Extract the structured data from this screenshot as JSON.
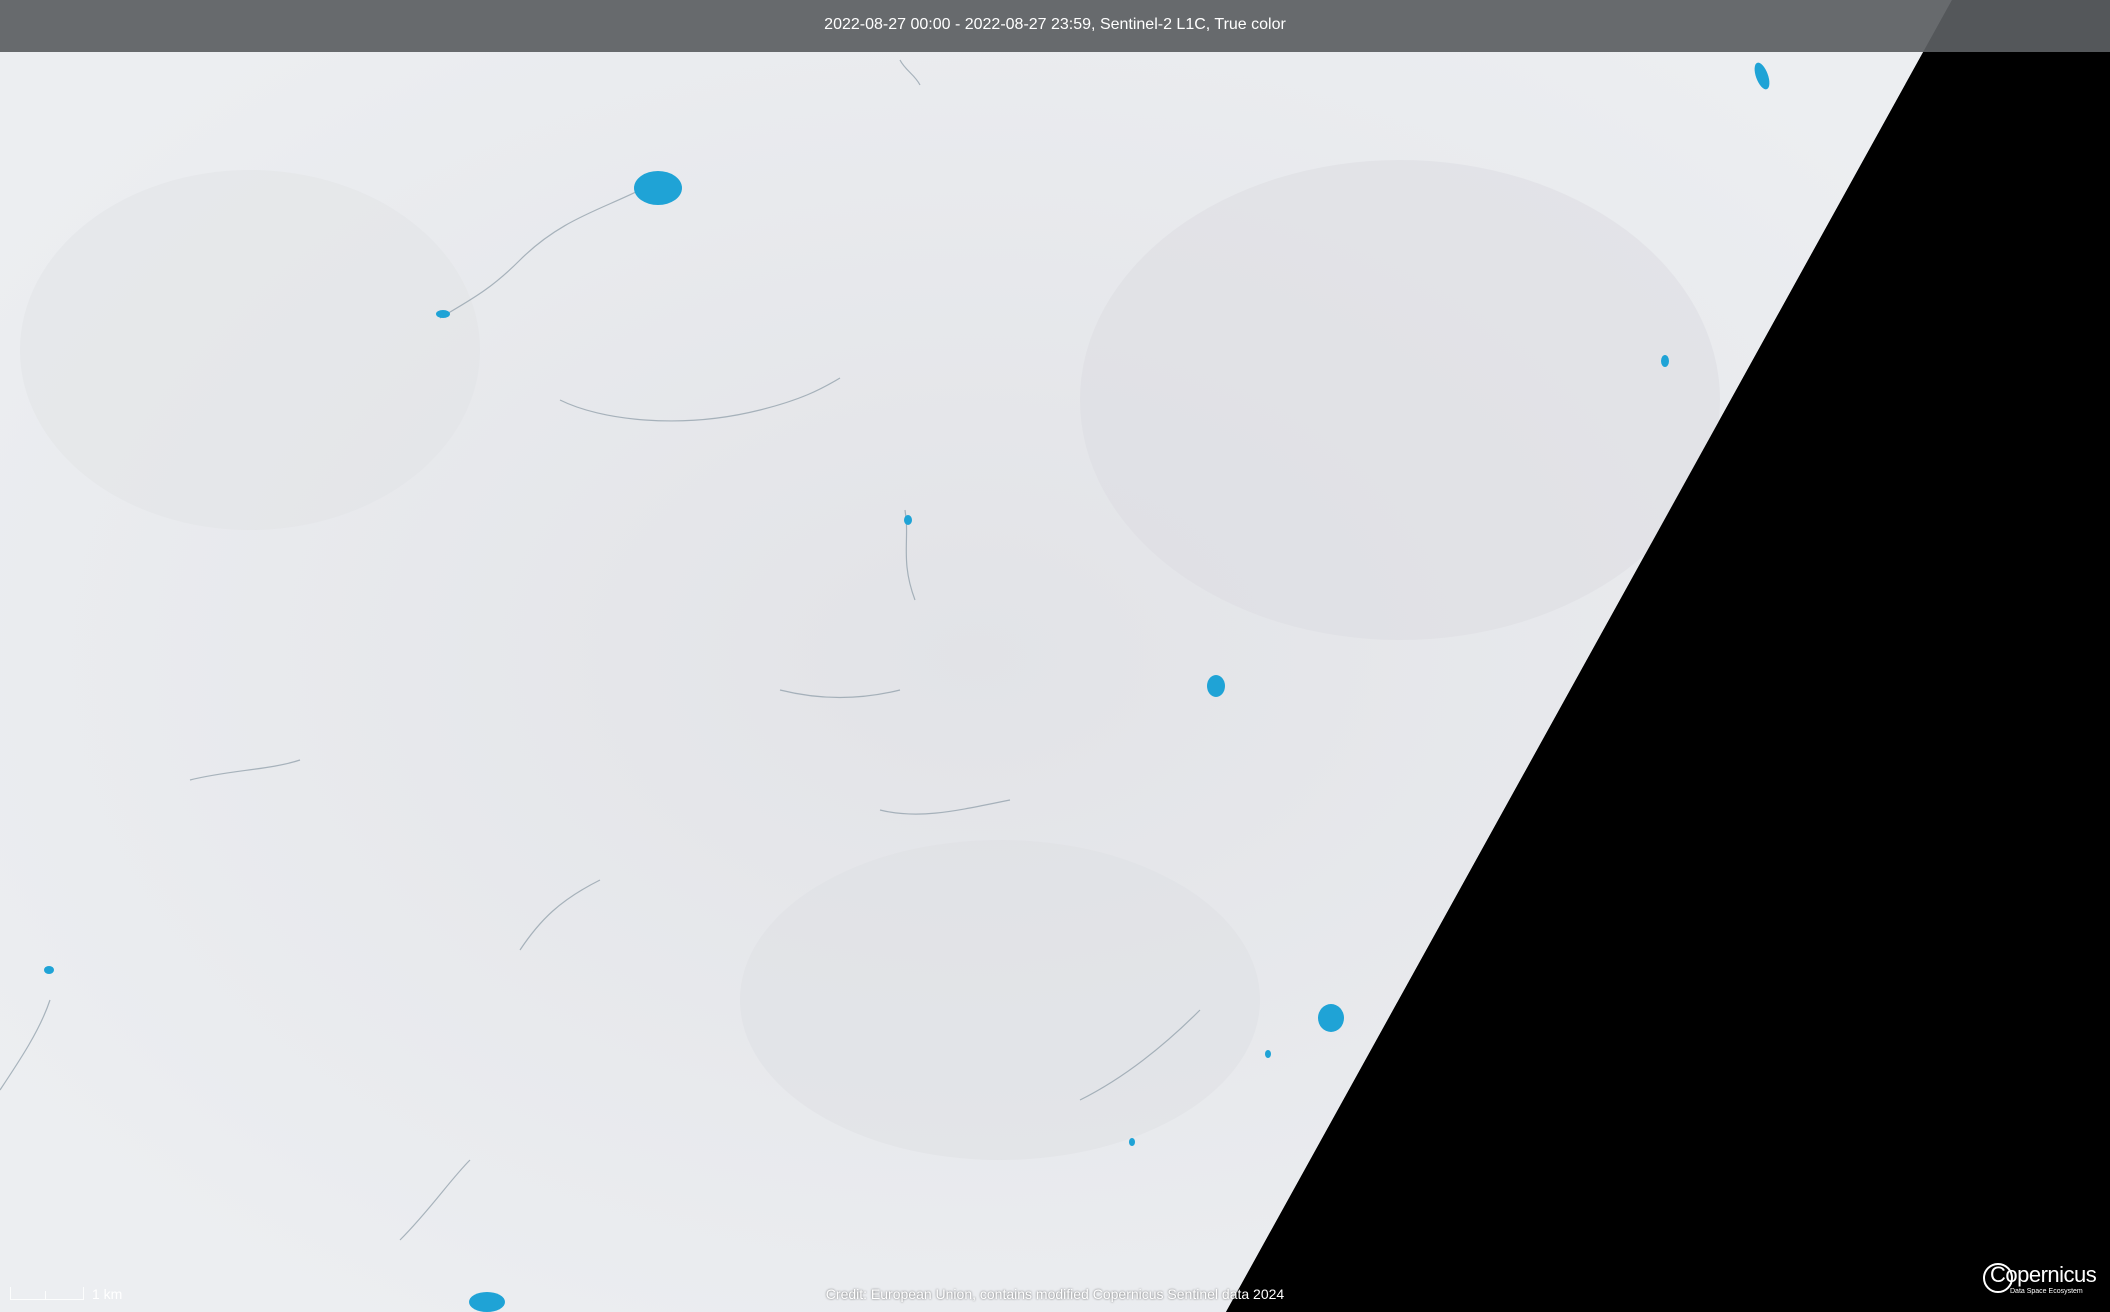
{
  "header": {
    "title": "2022-08-27 00:00 - 2022-08-27 23:59, Sentinel-2 L1C, True color"
  },
  "scale": {
    "label": "1 km"
  },
  "credit": {
    "text": "Credit: European Union, contains modified Copernicus Sentinel data 2024"
  },
  "logo": {
    "name": "Copernicus",
    "subtitle": "Data Space Ecosystem"
  },
  "colors": {
    "ice": "#e8e9ec",
    "meltwater": "#1fa3d6",
    "nodata": "#000000",
    "header_bg": "#5b5e62"
  }
}
